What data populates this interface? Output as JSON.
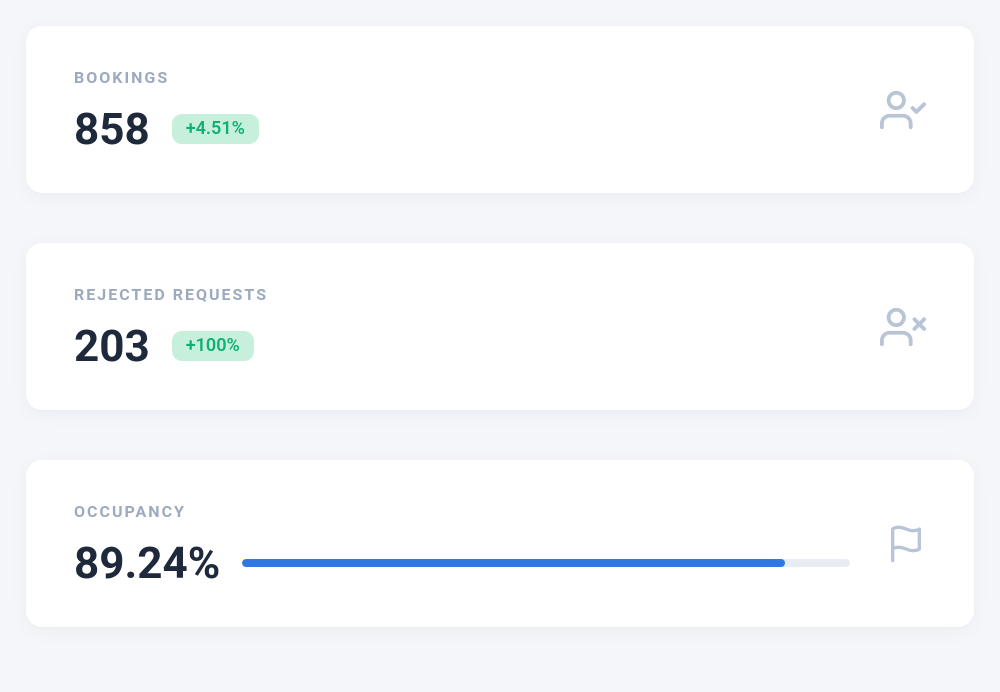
{
  "bookings": {
    "label": "BOOKINGS",
    "value": "858",
    "delta": "+4.51%"
  },
  "rejected": {
    "label": "REJECTED REQUESTS",
    "value": "203",
    "delta": "+100%"
  },
  "occupancy": {
    "label": "OCCUPANCY",
    "value": "89.24%",
    "pct": 89.24
  }
}
